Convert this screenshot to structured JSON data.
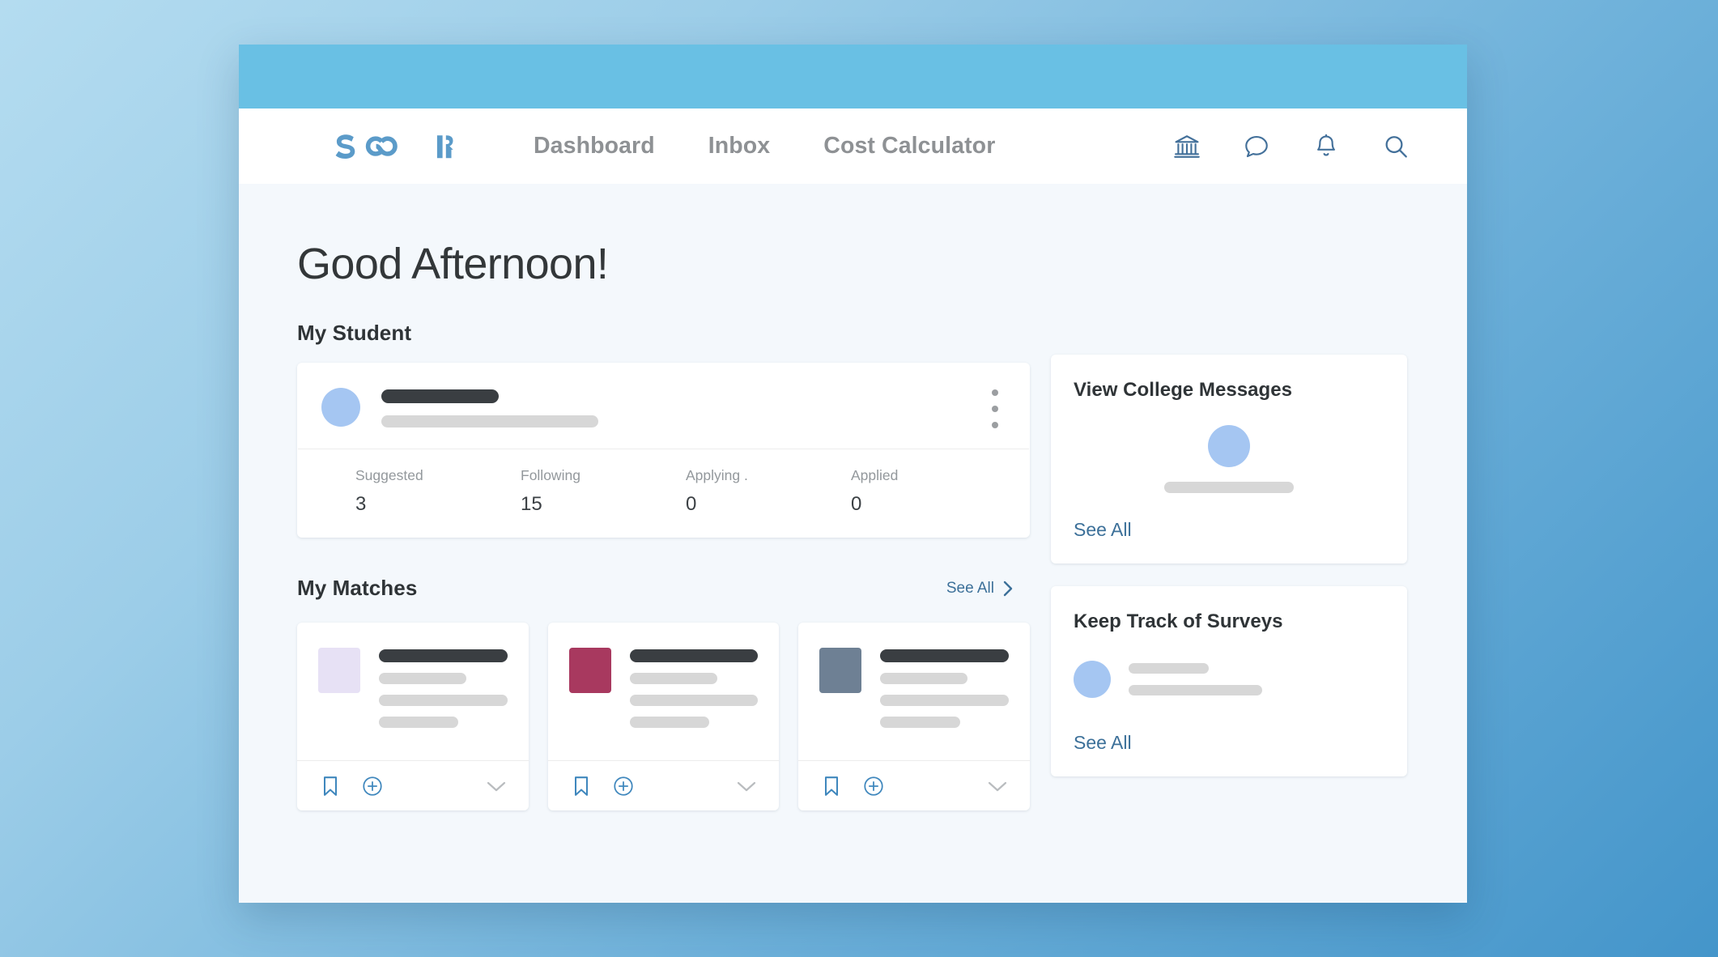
{
  "browser": {
    "topbar_color": "#69c0e4",
    "page_bg": "#f4f8fc"
  },
  "nav": {
    "logo_text": "SCOIR",
    "logo_color": "#5b9bc9",
    "links": [
      {
        "label": "Dashboard"
      },
      {
        "label": "Inbox"
      },
      {
        "label": "Cost Calculator"
      }
    ],
    "icons": [
      {
        "name": "bank-icon"
      },
      {
        "name": "chat-bubble-icon"
      },
      {
        "name": "bell-icon"
      },
      {
        "name": "search-icon"
      }
    ],
    "icon_color": "#43709a"
  },
  "main": {
    "greeting": "Good Afternoon!",
    "my_student": {
      "section_title": "My Student",
      "avatar_color": "#a5c6f2",
      "menu_icon": "kebab-menu-icon",
      "stats": [
        {
          "label": "Suggested",
          "value": "3"
        },
        {
          "label": "Following",
          "value": "15"
        },
        {
          "label": "Applying .",
          "value": "0"
        },
        {
          "label": "Applied",
          "value": "0"
        }
      ]
    },
    "my_matches": {
      "section_title": "My Matches",
      "see_all_label": "See All",
      "see_all_icon": "chevron-right-icon",
      "cards": [
        {
          "logo_color": "#e7e1f5",
          "bookmark_icon": "bookmark-icon",
          "add_icon": "plus-circle-icon",
          "expand_icon": "chevron-down-icon"
        },
        {
          "logo_color": "#a8395f",
          "bookmark_icon": "bookmark-icon",
          "add_icon": "plus-circle-icon",
          "expand_icon": "chevron-down-icon"
        },
        {
          "logo_color": "#6e8094",
          "bookmark_icon": "bookmark-icon",
          "add_icon": "plus-circle-icon",
          "expand_icon": "chevron-down-icon"
        }
      ]
    }
  },
  "sidebar": {
    "messages_card": {
      "title": "View College Messages",
      "link_label": "See All",
      "avatar_color": "#a5c6f2"
    },
    "surveys_card": {
      "title": "Keep Track of Surveys",
      "link_label": "See All",
      "avatar_color": "#a5c6f2"
    }
  },
  "colors": {
    "accent_blue": "#3c7099",
    "brand_blue": "#5b9bc9",
    "icon_blue": "#3f87bd",
    "skeleton_gray": "#d7d7d7",
    "skeleton_dark": "#3a3e42"
  }
}
